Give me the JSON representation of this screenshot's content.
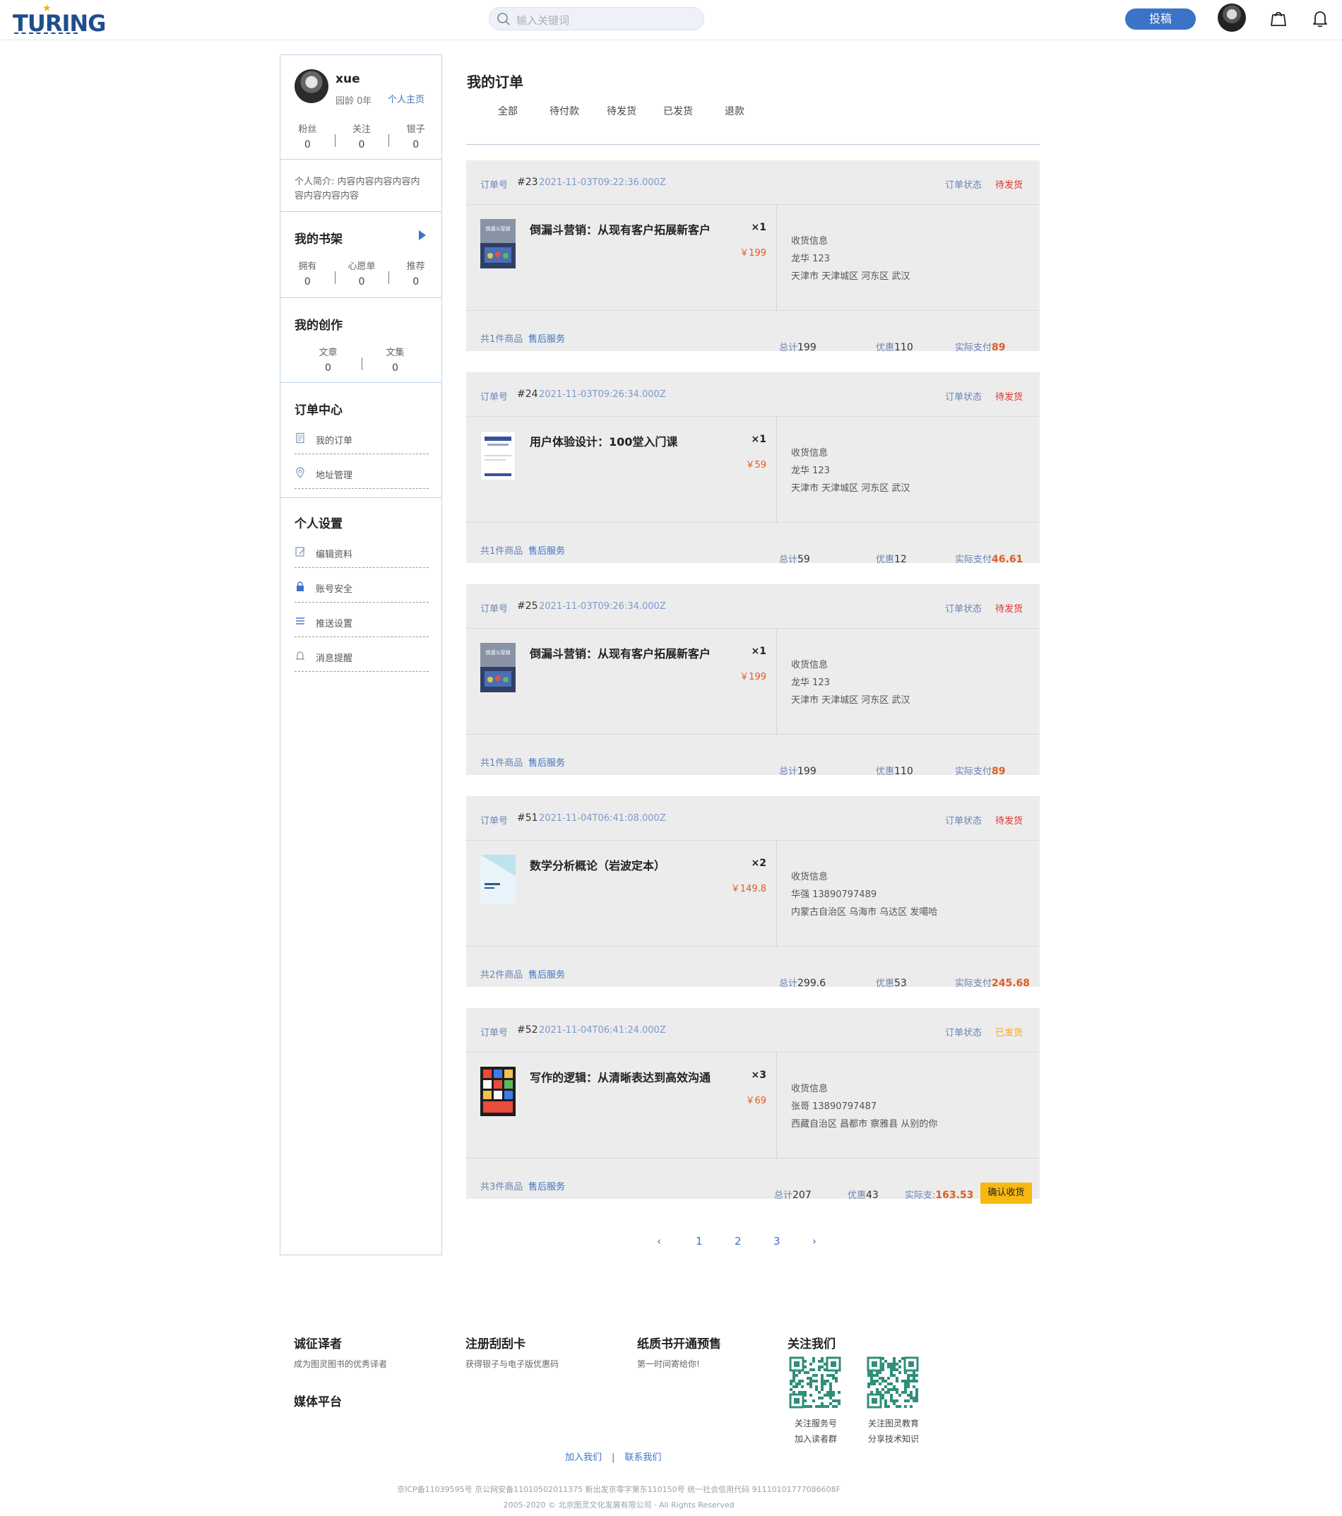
{
  "header": {
    "logo_text": "TURING",
    "search_placeholder": "输入关键词",
    "post_button": "投稿",
    "icons": [
      "search-icon",
      "shopping-bag-icon",
      "bell-icon"
    ]
  },
  "profile": {
    "name": "xue",
    "age": "园龄 0年",
    "home_link": "个人主页",
    "stats": [
      {
        "label": "粉丝",
        "value": "0"
      },
      {
        "label": "关注",
        "value": "0"
      },
      {
        "label": "银子",
        "value": "0"
      }
    ],
    "intro": "个人简介: 内容内容内容内容内容内容内容内容"
  },
  "shelf": {
    "title": "我的书架",
    "stats": [
      {
        "label": "拥有",
        "value": "0"
      },
      {
        "label": "心愿单",
        "value": "0"
      },
      {
        "label": "推荐",
        "value": "0"
      }
    ]
  },
  "creation": {
    "title": "我的创作",
    "stats": [
      {
        "label": "文章",
        "value": "0"
      },
      {
        "label": "文集",
        "value": "0"
      }
    ]
  },
  "order_center": {
    "title": "订单中心",
    "items": [
      {
        "label": "我的订单",
        "icon": "document-icon"
      },
      {
        "label": "地址管理",
        "icon": "location-pin-icon"
      }
    ]
  },
  "settings": {
    "title": "个人设置",
    "items": [
      {
        "label": "编辑资料",
        "icon": "edit-profile-icon"
      },
      {
        "label": "账号安全",
        "icon": "lock-icon"
      },
      {
        "label": "推送设置",
        "icon": "list-icon"
      },
      {
        "label": "消息提醒",
        "icon": "bell-icon"
      }
    ]
  },
  "orders_page": {
    "title": "我的订单",
    "tabs": [
      "全部",
      "待付款",
      "待发货",
      "已发货",
      "退款"
    ],
    "labels": {
      "order_no": "订单号",
      "status": "订单状态",
      "shipping": "收货信息",
      "after_sales": "售后服务",
      "total": "总计",
      "discount": "优惠",
      "paid": "实际支付",
      "paid_alt": "实际支:",
      "confirm": "确认收货"
    },
    "orders": [
      {
        "id": "#23",
        "time": "2021-11-03T09:22:36.000Z",
        "status": "待发货",
        "book": "倒漏斗营销：从现有客户拓展新客户",
        "qty": "×1",
        "price": "￥199",
        "cover": "funnel-book-cover",
        "receiver": "龙华 123",
        "address": "天津市 天津城区 河东区 武汉",
        "count": "共1件商品",
        "total": "199",
        "discount": "110",
        "paid": "89"
      },
      {
        "id": "#24",
        "time": "2021-11-03T09:26:34.000Z",
        "status": "待发货",
        "book": "用户体验设计：100堂入门课",
        "qty": "×1",
        "price": "￥59",
        "cover": "ux-book-cover",
        "receiver": "龙华 123",
        "address": "天津市 天津城区 河东区 武汉",
        "count": "共1件商品",
        "total": "59",
        "discount": "12",
        "paid": "46.61"
      },
      {
        "id": "#25",
        "time": "2021-11-03T09:26:34.000Z",
        "status": "待发货",
        "book": "倒漏斗营销：从现有客户拓展新客户",
        "qty": "×1",
        "price": "￥199",
        "cover": "funnel-book-cover",
        "receiver": "龙华 123",
        "address": "天津市 天津城区 河东区 武汉",
        "count": "共1件商品",
        "total": "199",
        "discount": "110",
        "paid": "89"
      },
      {
        "id": "#51",
        "time": "2021-11-04T06:41:08.000Z",
        "status": "待发货",
        "book": "数学分析概论（岩波定本）",
        "qty": "×2",
        "price": "￥149.8",
        "cover": "math-book-cover",
        "receiver": "华强 13890797489",
        "address": "内蒙古自治区 乌海市 乌达区 发噶哈",
        "count": "共2件商品",
        "total": "299.6",
        "discount": "53",
        "paid": "245.68"
      },
      {
        "id": "#52",
        "time": "2021-11-04T06:41:24.000Z",
        "status": "已发货",
        "book": "写作的逻辑：从清晰表达到高效沟通",
        "qty": "×3",
        "price": "￥69",
        "cover": "writing-book-cover",
        "receiver": "张哥 13890797487",
        "address": "西藏自治区 昌都市 察雅县 从别的你",
        "count": "共3件商品",
        "total": "207",
        "discount": "43",
        "paid": "163.53"
      }
    ],
    "status_colors": {
      "pending": "#e0302b",
      "shipped": "#f5a623"
    },
    "pagination": {
      "prev": "‹",
      "pages": [
        "1",
        "2",
        "3"
      ],
      "next": "›"
    }
  },
  "footer": {
    "cols": [
      {
        "title": "诚征译者",
        "sub": "成为图灵图书的优秀译者"
      },
      {
        "title": "注册刮刮卡",
        "sub": "获得银子与电子版优惠码"
      },
      {
        "title": "纸质书开通预售",
        "sub": "第一时间寄给你!"
      }
    ],
    "media": "媒体平台",
    "follow": "关注我们",
    "qr": [
      {
        "line1": "关注服务号",
        "line2": "加入读者群"
      },
      {
        "line1": "关注图灵教育",
        "line2": "分享技术知识"
      }
    ],
    "links": [
      "加入我们",
      "联系我们"
    ],
    "icp": "京ICP备11039595号 京公网安备11010502011375 新出发京零字第东110150号 统一社会信用代码 91110101777086608F",
    "copyright": "2005-2020 © 北京图灵文化发展有限公司 · All Rights Reserved"
  }
}
